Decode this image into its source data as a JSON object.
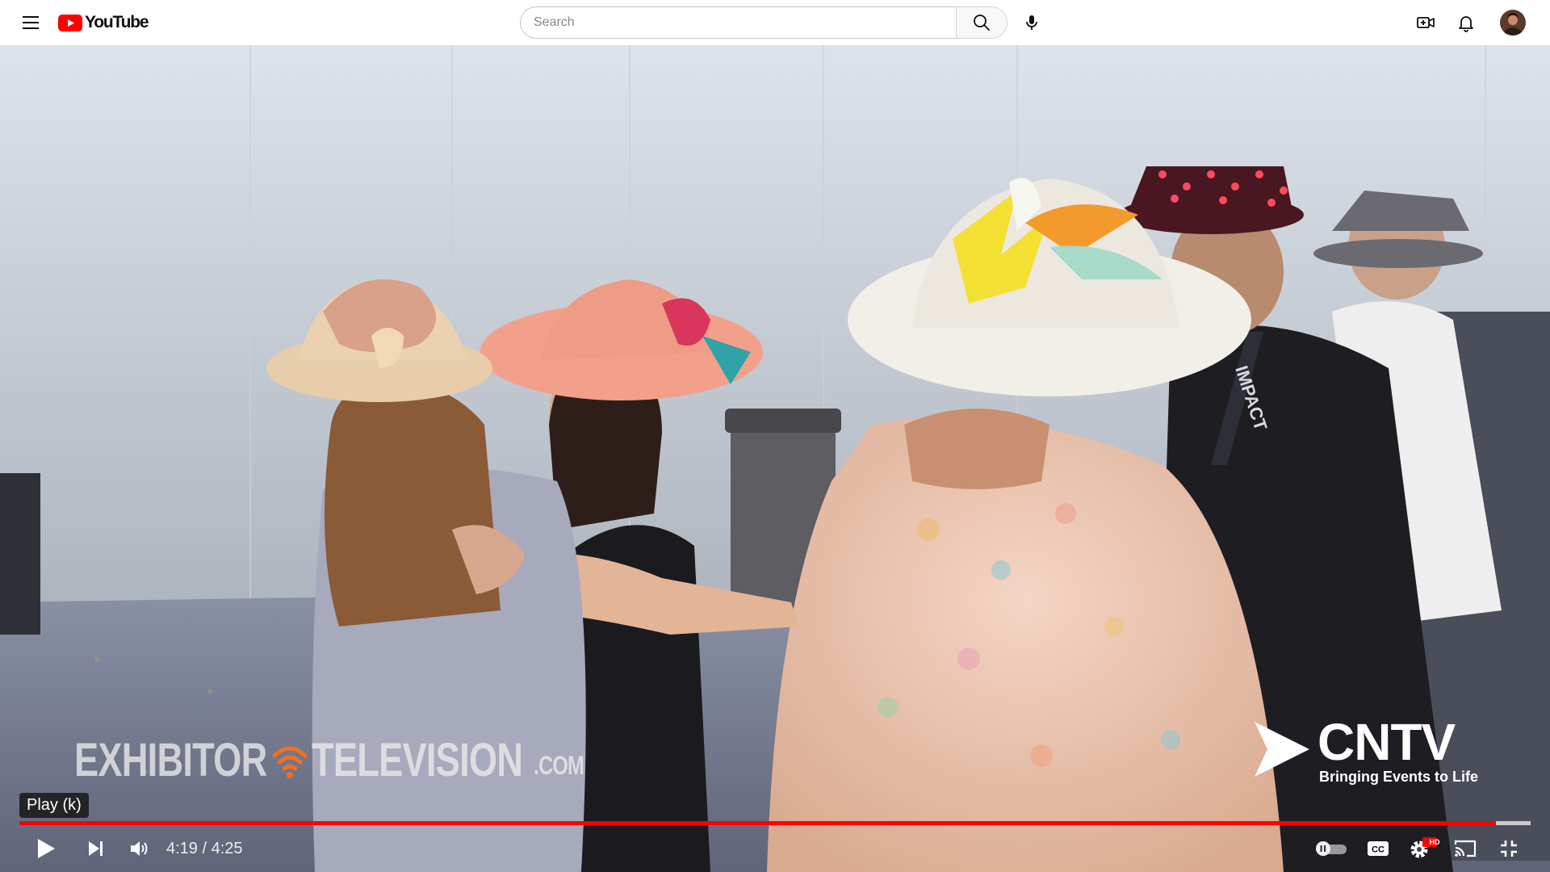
{
  "app": {
    "logo_text": "YouTube",
    "brand_color": "#ff0000"
  },
  "search": {
    "placeholder": "Search",
    "value": ""
  },
  "video": {
    "watermark_left": "EXHIBITOR",
    "watermark_left_2": "TELEVISION",
    "watermark_left_suffix": ".COM",
    "watermark_right": "CNTV",
    "watermark_right_tagline": "Bringing Events to Life",
    "lanyard_text": "IMPACT"
  },
  "player": {
    "tooltip": "Play (k)",
    "current_time": "4:19",
    "separator": " / ",
    "duration": "4:25",
    "progress_fraction": 0.977,
    "hd_badge": "HD",
    "progress_color": "#ff0000"
  },
  "icons": {
    "menu": "hamburger-menu-icon",
    "search": "search-icon",
    "mic": "microphone-icon",
    "create": "create-video-icon",
    "notifications": "bell-icon",
    "play": "play-icon",
    "next": "next-icon",
    "volume": "volume-icon",
    "autoplay": "autoplay-toggle-icon",
    "captions": "captions-icon",
    "settings": "settings-gear-icon",
    "cast": "cast-icon",
    "fullscreen_exit": "exit-fullscreen-icon"
  }
}
